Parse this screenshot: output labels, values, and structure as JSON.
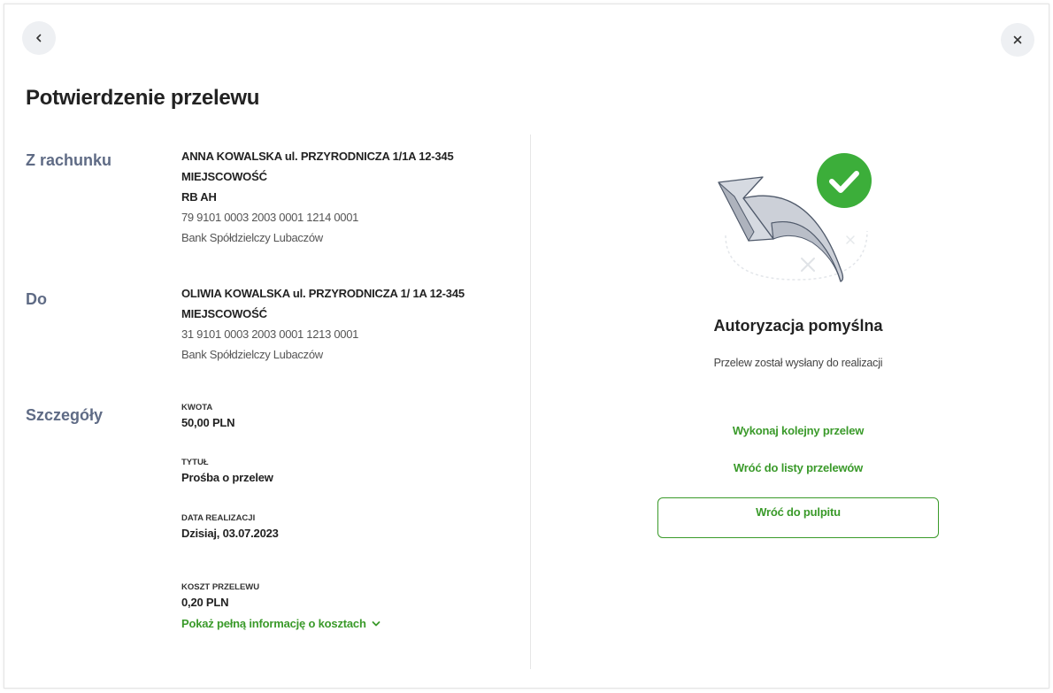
{
  "header": {
    "title": "Potwierdzenie przelewu"
  },
  "from": {
    "label": "Z rachunku",
    "name_line1": "ANNA KOWALSKA ul. PRZYRODNICZA 1/1A 12-345",
    "name_line2": "MIEJSCOWOŚĆ",
    "account_name": "RB AH",
    "account_number": "79 9101 0003 2003 0001 1214 0001",
    "bank": "Bank Spółdzielczy Lubaczów"
  },
  "to": {
    "label": "Do",
    "name_line1": "OLIWIA KOWALSKA ul. PRZYRODNICZA 1/ 1A 12-345",
    "name_line2": "MIEJSCOWOŚĆ",
    "account_number": "31 9101 0003 2003 0001 1213 0001",
    "bank": "Bank Spółdzielczy Lubaczów"
  },
  "details": {
    "label": "Szczegóły",
    "amount_caption": "KWOTA",
    "amount_value": "50,00 PLN",
    "title_caption": "TYTUŁ",
    "title_value": "Prośba o przelew",
    "date_caption": "DATA REALIZACJI",
    "date_value": "Dzisiaj, 03.07.2023",
    "cost_caption": "KOSZT PRZELEWU",
    "cost_value": "0,20 PLN",
    "cost_link": "Pokaż pełną informację o kosztach"
  },
  "result": {
    "title": "Autoryzacja pomyślna",
    "subtitle": "Przelew został wysłany do realizacji",
    "link_next": "Wykonaj kolejny przelew",
    "link_list": "Wróć do listy przelewów",
    "button_dashboard": "Wróć do pulpitu"
  },
  "icons": {
    "back": "chevron-left-icon",
    "close": "close-icon",
    "expand": "chevron-down-icon",
    "success": "check-circle-icon"
  },
  "colors": {
    "accent": "#3a9a2a",
    "section_label": "#5f6b85",
    "success_badge": "#3cae3a"
  }
}
